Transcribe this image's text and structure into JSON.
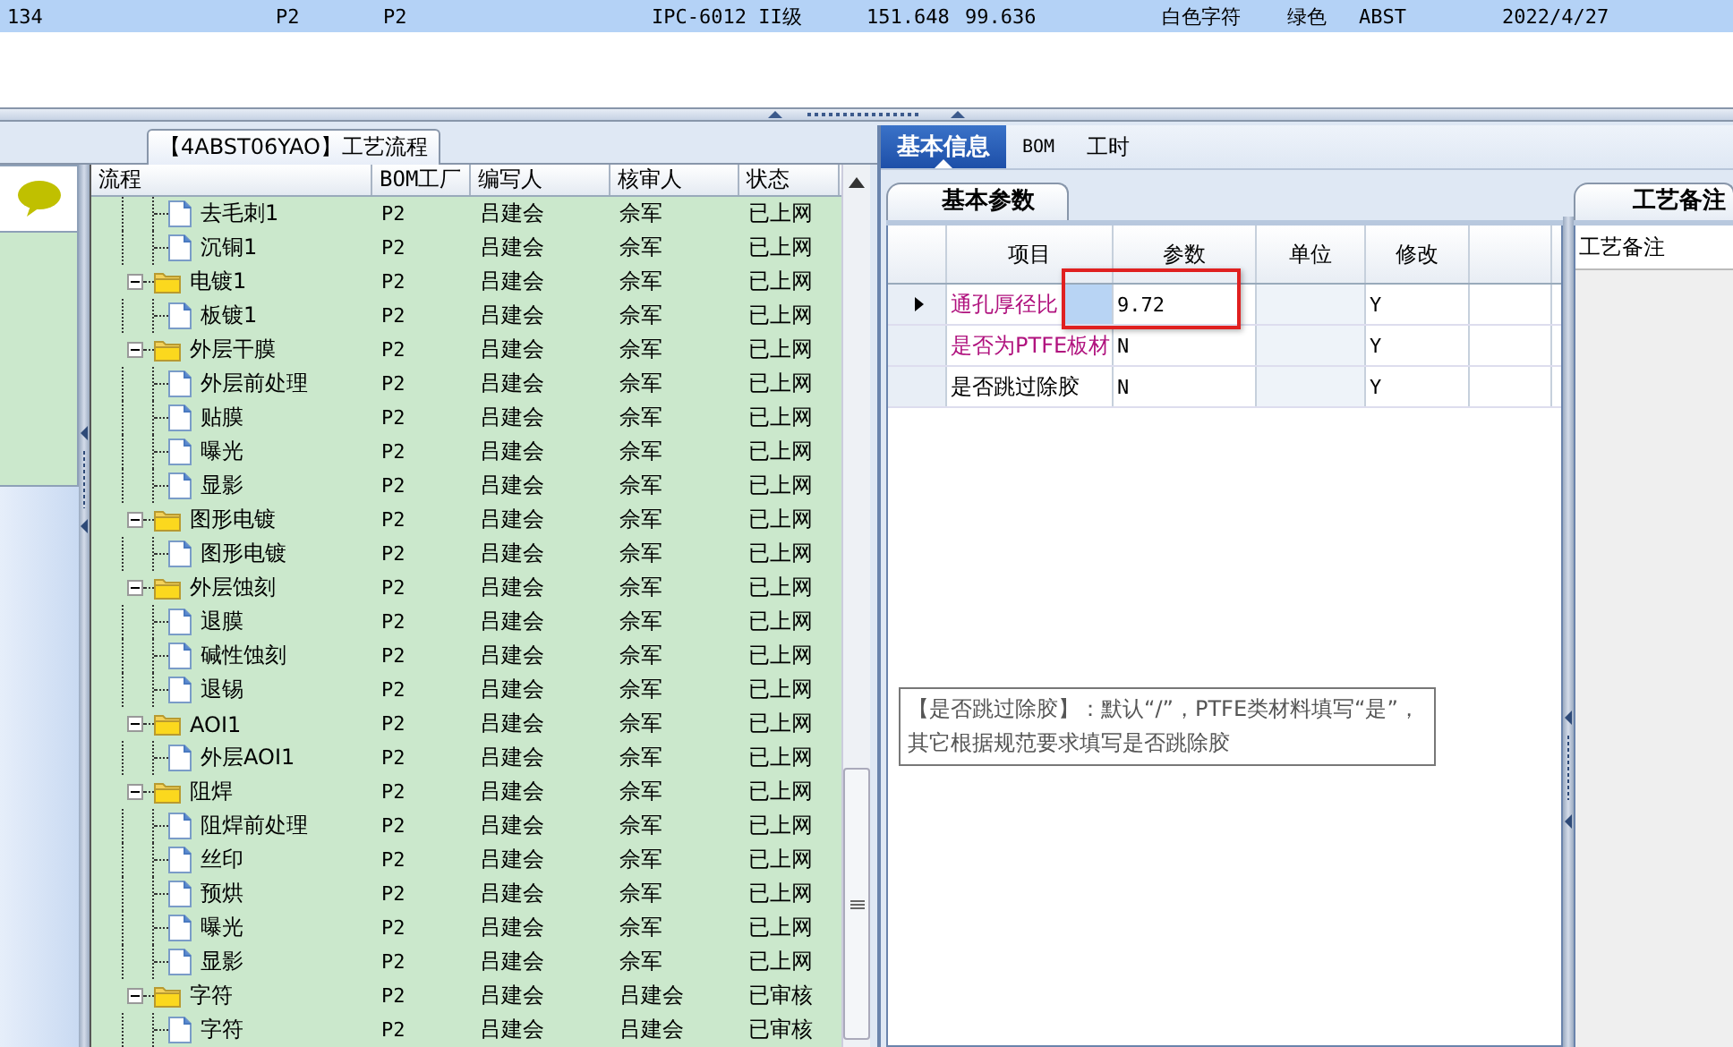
{
  "top_table": {
    "rows": [
      {
        "selected": true,
        "cells": [
          "134",
          "P2",
          "P2",
          "IPC-6012 II级",
          "151.648",
          "99.636",
          "白色字符",
          "绿色",
          "ABST",
          "2022/4/27"
        ]
      }
    ]
  },
  "flow_panel": {
    "title": "【4ABST06YAO】工艺流程",
    "columns": [
      "流程",
      "BOM工厂",
      "编写人",
      "核审人",
      "状态"
    ],
    "tree": [
      {
        "children": [
          {
            "label": "去毛刺1",
            "factory": "P2",
            "writer": "吕建会",
            "reviewer": "佘军",
            "status": "已上网"
          },
          {
            "label": "沉铜1",
            "factory": "P2",
            "writer": "吕建会",
            "reviewer": "佘军",
            "status": "已上网"
          }
        ]
      },
      {
        "label": "电镀1",
        "factory": "P2",
        "writer": "吕建会",
        "reviewer": "佘军",
        "status": "已上网",
        "expanded": true,
        "children": [
          {
            "label": "板镀1",
            "factory": "P2",
            "writer": "吕建会",
            "reviewer": "佘军",
            "status": "已上网"
          }
        ]
      },
      {
        "label": "外层干膜",
        "factory": "P2",
        "writer": "吕建会",
        "reviewer": "佘军",
        "status": "已上网",
        "expanded": true,
        "children": [
          {
            "label": "外层前处理",
            "factory": "P2",
            "writer": "吕建会",
            "reviewer": "佘军",
            "status": "已上网"
          },
          {
            "label": "贴膜",
            "factory": "P2",
            "writer": "吕建会",
            "reviewer": "佘军",
            "status": "已上网"
          },
          {
            "label": "曝光",
            "factory": "P2",
            "writer": "吕建会",
            "reviewer": "佘军",
            "status": "已上网"
          },
          {
            "label": "显影",
            "factory": "P2",
            "writer": "吕建会",
            "reviewer": "佘军",
            "status": "已上网"
          }
        ]
      },
      {
        "label": "图形电镀",
        "factory": "P2",
        "writer": "吕建会",
        "reviewer": "佘军",
        "status": "已上网",
        "expanded": true,
        "children": [
          {
            "label": "图形电镀",
            "factory": "P2",
            "writer": "吕建会",
            "reviewer": "佘军",
            "status": "已上网"
          }
        ]
      },
      {
        "label": "外层蚀刻",
        "factory": "P2",
        "writer": "吕建会",
        "reviewer": "佘军",
        "status": "已上网",
        "expanded": true,
        "children": [
          {
            "label": "退膜",
            "factory": "P2",
            "writer": "吕建会",
            "reviewer": "佘军",
            "status": "已上网"
          },
          {
            "label": "碱性蚀刻",
            "factory": "P2",
            "writer": "吕建会",
            "reviewer": "佘军",
            "status": "已上网"
          },
          {
            "label": "退锡",
            "factory": "P2",
            "writer": "吕建会",
            "reviewer": "佘军",
            "status": "已上网"
          }
        ]
      },
      {
        "label": "AOI1",
        "factory": "P2",
        "writer": "吕建会",
        "reviewer": "佘军",
        "status": "已上网",
        "expanded": true,
        "children": [
          {
            "label": "外层AOI1",
            "factory": "P2",
            "writer": "吕建会",
            "reviewer": "佘军",
            "status": "已上网"
          }
        ]
      },
      {
        "label": "阻焊",
        "factory": "P2",
        "writer": "吕建会",
        "reviewer": "佘军",
        "status": "已上网",
        "expanded": true,
        "children": [
          {
            "label": "阻焊前处理",
            "factory": "P2",
            "writer": "吕建会",
            "reviewer": "佘军",
            "status": "已上网"
          },
          {
            "label": "丝印",
            "factory": "P2",
            "writer": "吕建会",
            "reviewer": "佘军",
            "status": "已上网"
          },
          {
            "label": "预烘",
            "factory": "P2",
            "writer": "吕建会",
            "reviewer": "佘军",
            "status": "已上网"
          },
          {
            "label": "曝光",
            "factory": "P2",
            "writer": "吕建会",
            "reviewer": "佘军",
            "status": "已上网"
          },
          {
            "label": "显影",
            "factory": "P2",
            "writer": "吕建会",
            "reviewer": "佘军",
            "status": "已上网"
          }
        ]
      },
      {
        "label": "字符",
        "factory": "P2",
        "writer": "吕建会",
        "reviewer": "吕建会",
        "status": "已审核",
        "expanded": true,
        "children": [
          {
            "label": "字符",
            "factory": "P2",
            "writer": "吕建会",
            "reviewer": "吕建会",
            "status": "已审核"
          }
        ]
      }
    ]
  },
  "detail_panel": {
    "tabs": [
      {
        "label": "基本信息",
        "selected": true
      },
      {
        "label": "BOM",
        "selected": false
      },
      {
        "label": "工时",
        "selected": false
      }
    ],
    "param_tab": "基本参数",
    "columns": [
      "项目",
      "参数",
      "单位",
      "修改"
    ],
    "rows": [
      {
        "item": "通孔厚径比",
        "value": "9.72",
        "modify": "Y",
        "selected": true,
        "marked": true,
        "color": "#b0127e"
      },
      {
        "item": "是否为PTFE板材",
        "value": "N",
        "modify": "Y",
        "selected": false,
        "color": "#b0127e"
      },
      {
        "item": "是否跳过除胶",
        "value": "N",
        "modify": "Y",
        "selected": false,
        "color": "#000000"
      }
    ],
    "note": "【是否跳过除胶】：默认“/”，PTFE类材料填写“是”，其它根据规范要求填写是否跳除胶"
  },
  "remark_panel": {
    "tab": "工艺备注",
    "header": "工艺备注"
  }
}
